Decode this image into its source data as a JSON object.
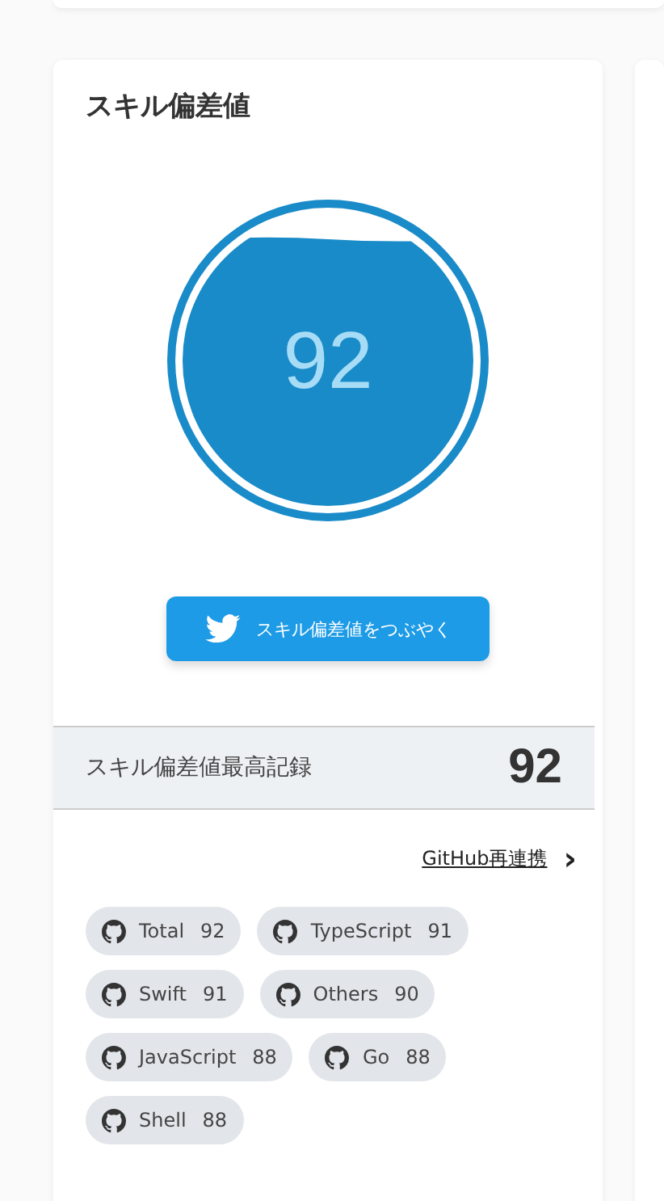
{
  "card": {
    "title": "スキル偏差値"
  },
  "gauge": {
    "value": "92"
  },
  "tweet_button": {
    "label": "スキル偏差値をつぶやく"
  },
  "record": {
    "label": "スキル偏差値最高記録",
    "value": "92"
  },
  "relink": {
    "label": "GitHub再連携",
    "arrow": "›"
  },
  "skills": [
    {
      "name": "Total",
      "score": "92"
    },
    {
      "name": "TypeScript",
      "score": "91"
    },
    {
      "name": "Swift",
      "score": "91"
    },
    {
      "name": "Others",
      "score": "90"
    },
    {
      "name": "JavaScript",
      "score": "88"
    },
    {
      "name": "Go",
      "score": "88"
    },
    {
      "name": "Shell",
      "score": "88"
    }
  ]
}
